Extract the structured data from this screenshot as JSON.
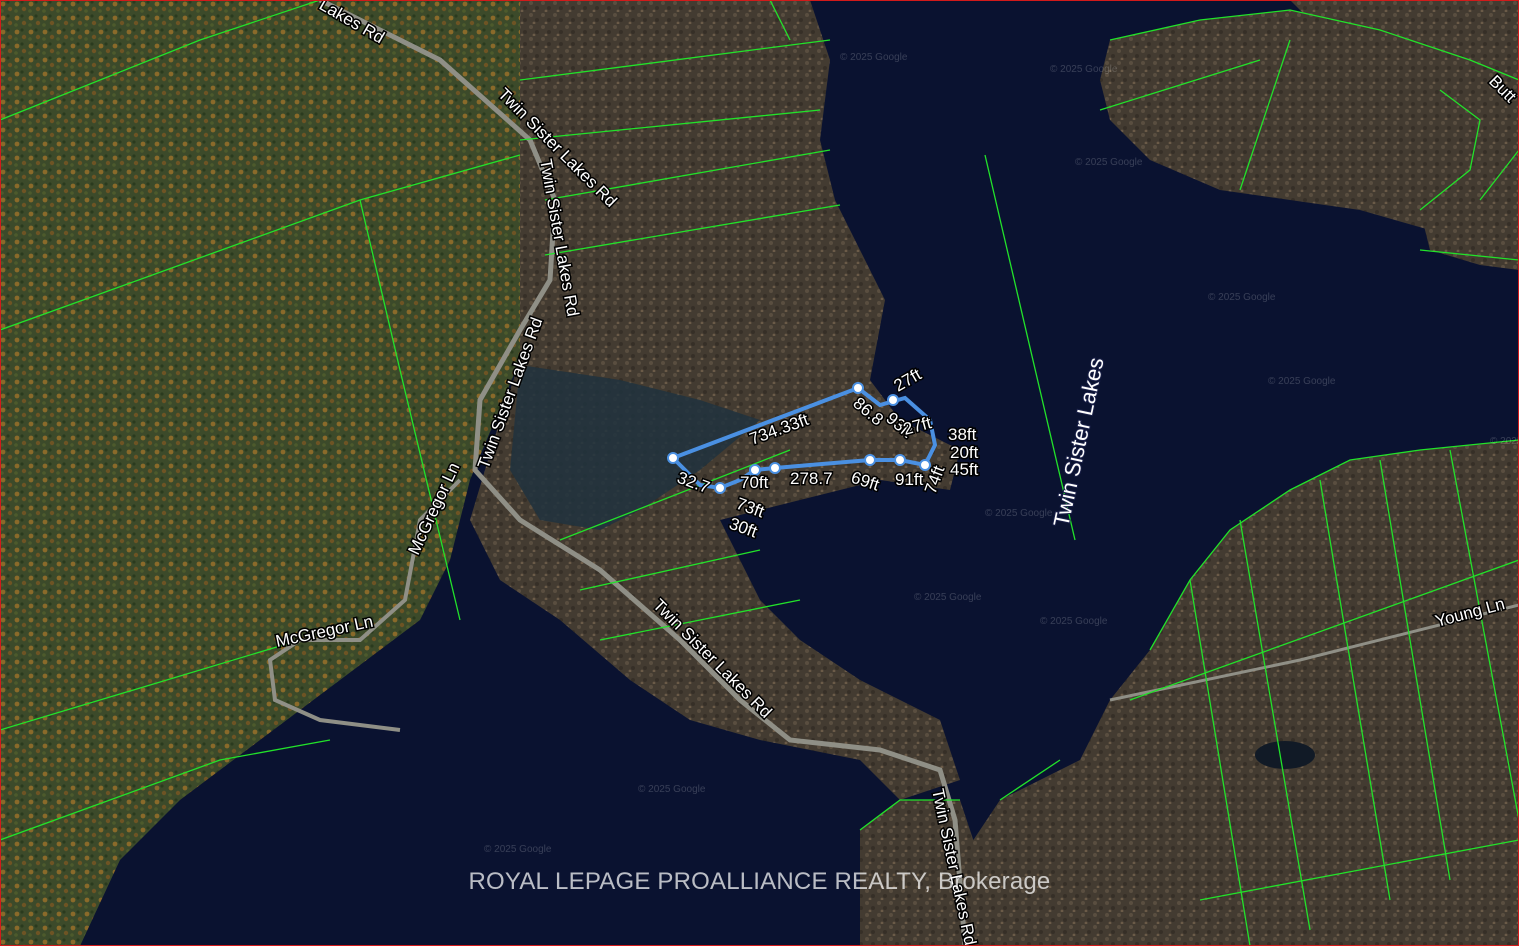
{
  "roads": {
    "twin_sister_top": "Twin Sister Lakes Rd",
    "twin_sister_upper": "Twin Sister Lakes Rd",
    "twin_sister_mid": "Twin Sister Lakes Rd",
    "twin_sister_lower": "Twin Sister Lakes Rd",
    "twin_sister_bottom": "Twin Sister Lakes Rd",
    "top_corner": "Lakes Rd",
    "mcgregor_vertical": "McGregor Ln",
    "mcgregor_horizontal": "McGregor Ln",
    "young": "Young Ln",
    "butt": "Butt"
  },
  "lake_label": "Twin Sister Lakes",
  "measurements": {
    "north_side": "734.33ft",
    "lot_labels": [
      "32.7",
      "73ft",
      "70ft",
      "278.7",
      "69ft",
      "86.8",
      "93ft",
      "27ft",
      "38ft",
      "20ft",
      "45ft",
      "74ft",
      "91ft",
      "30ft",
      "27ft"
    ]
  },
  "imagery_credit": "© 2025 Google",
  "watermark": "ROYAL LEPAGE PROALLIANCE REALTY, Brokerage",
  "colors": {
    "water": "#0a1230",
    "parcel_lines": "#22e22a",
    "measurement_line": "#4a90e2",
    "forest_orange": "#8a6a2a",
    "forest_green": "#2f4a26",
    "forest_brown": "#4a3f33",
    "frame": "#d21a1a"
  }
}
